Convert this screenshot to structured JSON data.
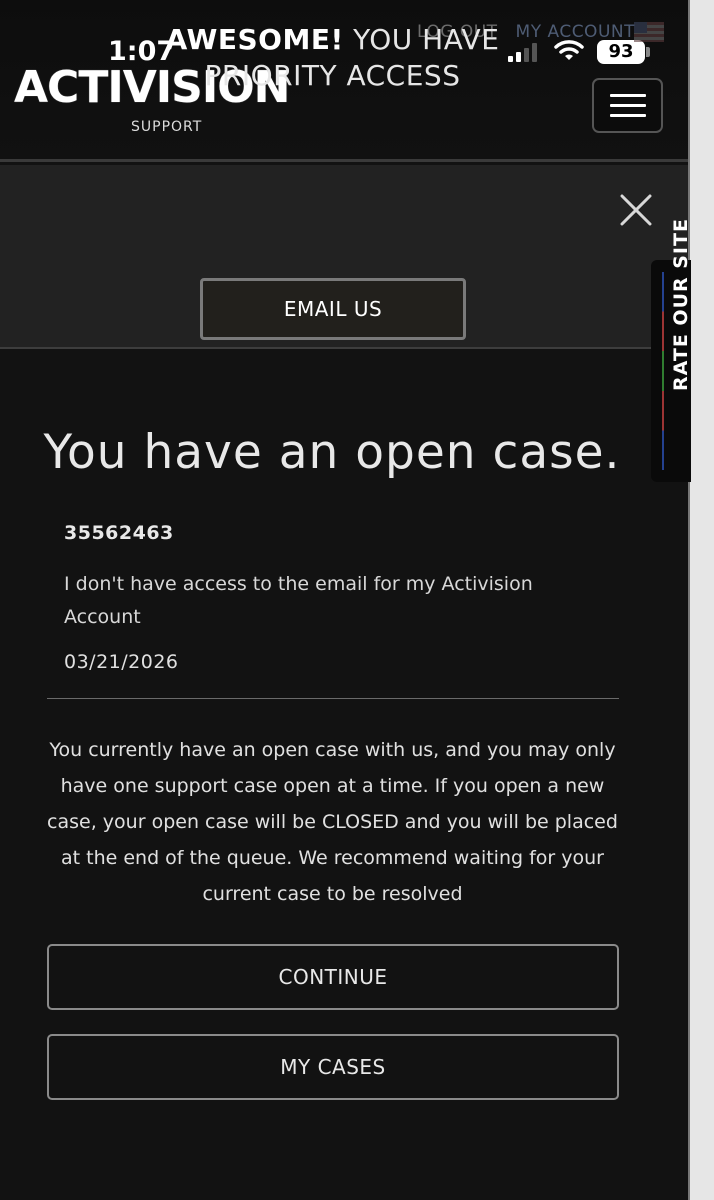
{
  "status_bar": {
    "time": "1:07",
    "battery": "93"
  },
  "header": {
    "logo_text": "ACTIVISION",
    "logo_sub": "SUPPORT",
    "logout_label": "LOG OUT",
    "my_account_label": "MY ACCOUNT"
  },
  "banner": {
    "title_bold": "AWESOME!",
    "title_rest": " YOU HAVE PRIORITY ACCESS",
    "email_button": "EMAIL US"
  },
  "rate_tab": {
    "label": "RATE OUR SITE"
  },
  "case": {
    "heading": "You have an open case.",
    "id": "35562463",
    "description": "I don't have access to the email for my Activision Account",
    "date": "03/21/2026",
    "notice": "You currently have an open case with us, and you may only have one support case open at a time. If you open a new case, your open case will be CLOSED and you will be placed at the end of the queue. We recommend waiting for your current case to be resolved"
  },
  "actions": {
    "continue_label": "CONTINUE",
    "my_cases_label": "MY CASES"
  }
}
